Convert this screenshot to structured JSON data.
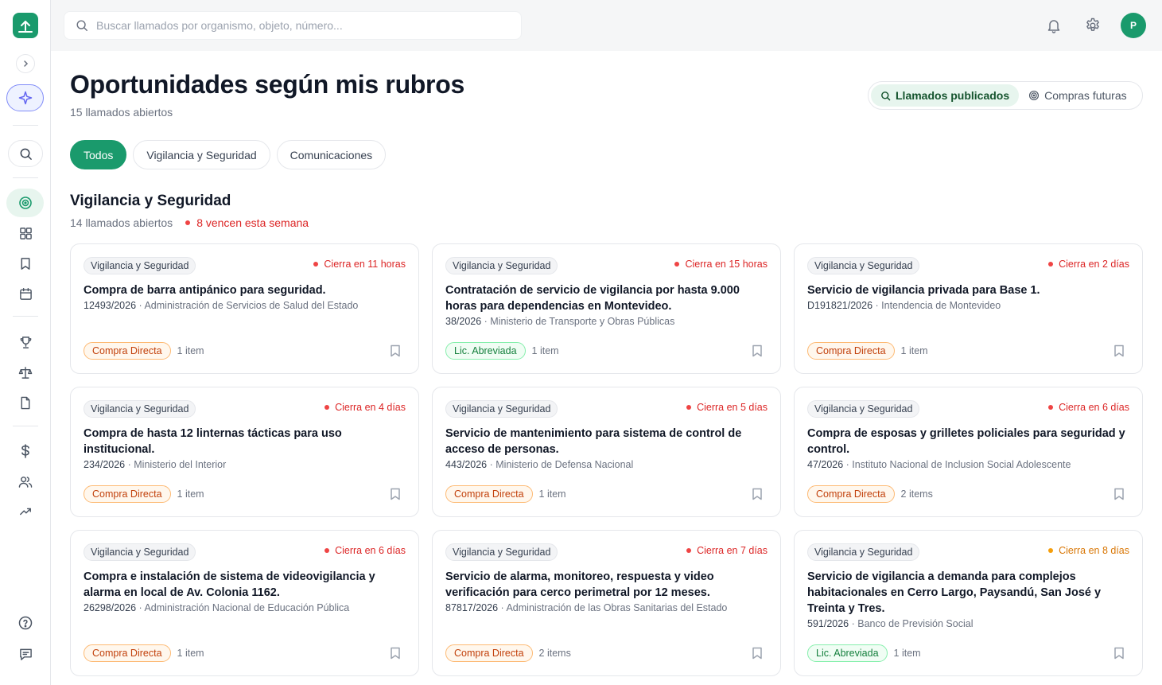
{
  "search": {
    "placeholder": "Buscar llamados por organismo, objeto, número..."
  },
  "user": {
    "initial": "P"
  },
  "page": {
    "title": "Oportunidades según mis rubros",
    "subtitle": "15 llamados abiertos"
  },
  "segments": [
    {
      "label": "Llamados publicados",
      "active": true
    },
    {
      "label": "Compras futuras",
      "active": false
    }
  ],
  "filters": [
    "Todos",
    "Vigilancia y Seguridad",
    "Comunicaciones"
  ],
  "section": {
    "title": "Vigilancia y Seguridad",
    "open_count": "14 llamados abiertos",
    "warning": "8 vencen esta semana"
  },
  "cards": [
    {
      "tag": "Vigilancia y Seguridad",
      "deadline": "Cierra en 11 horas",
      "urgency": "red",
      "title": "Compra de barra antipánico para seguridad.",
      "number": "12493/2026",
      "org": "Administración de Servicios de Salud del Estado",
      "type": "Compra Directa",
      "type_color": "orange",
      "items": "1 item"
    },
    {
      "tag": "Vigilancia y Seguridad",
      "deadline": "Cierra en 15 horas",
      "urgency": "red",
      "title": "Contratación de servicio de vigilancia por hasta 9.000 horas para dependencias en Montevideo.",
      "number": "38/2026",
      "org": "Ministerio de Transporte y Obras Públicas",
      "type": "Lic. Abreviada",
      "type_color": "green",
      "items": "1 item"
    },
    {
      "tag": "Vigilancia y Seguridad",
      "deadline": "Cierra en 2 días",
      "urgency": "red",
      "title": "Servicio de vigilancia privada para Base 1.",
      "number": "D191821/2026",
      "org": "Intendencia de Montevideo",
      "type": "Compra Directa",
      "type_color": "orange",
      "items": "1 item"
    },
    {
      "tag": "Vigilancia y Seguridad",
      "deadline": "Cierra en 4 días",
      "urgency": "red",
      "title": "Compra de hasta 12 linternas tácticas para uso institucional.",
      "number": "234/2026",
      "org": "Ministerio del Interior",
      "type": "Compra Directa",
      "type_color": "orange",
      "items": "1 item"
    },
    {
      "tag": "Vigilancia y Seguridad",
      "deadline": "Cierra en 5 días",
      "urgency": "red",
      "title": "Servicio de mantenimiento para sistema de control de acceso de personas.",
      "number": "443/2026",
      "org": "Ministerio de Defensa Nacional",
      "type": "Compra Directa",
      "type_color": "orange",
      "items": "1 item"
    },
    {
      "tag": "Vigilancia y Seguridad",
      "deadline": "Cierra en 6 días",
      "urgency": "red",
      "title": "Compra de esposas y grilletes policiales para seguridad y control.",
      "number": "47/2026",
      "org": "Instituto Nacional de Inclusion Social Adolescente",
      "type": "Compra Directa",
      "type_color": "orange",
      "items": "2 items"
    },
    {
      "tag": "Vigilancia y Seguridad",
      "deadline": "Cierra en 6 días",
      "urgency": "red",
      "title": "Compra e instalación de sistema de videovigilancia y alarma en local de Av. Colonia 1162.",
      "number": "26298/2026",
      "org": "Administración Nacional de Educación Pública",
      "type": "Compra Directa",
      "type_color": "orange",
      "items": "1 item"
    },
    {
      "tag": "Vigilancia y Seguridad",
      "deadline": "Cierra en 7 días",
      "urgency": "red",
      "title": "Servicio de alarma, monitoreo, respuesta y video verificación para cerco perimetral por 12 meses.",
      "number": "87817/2026",
      "org": "Administración de las Obras Sanitarias del Estado",
      "type": "Compra Directa",
      "type_color": "orange",
      "items": "2 items"
    },
    {
      "tag": "Vigilancia y Seguridad",
      "deadline": "Cierra en 8 días",
      "urgency": "orange",
      "title": "Servicio de vigilancia a demanda para complejos habitacionales en Cerro Largo, Paysandú, San José y Treinta y Tres.",
      "number": "591/2026",
      "org": "Banco de Previsión Social",
      "type": "Lic. Abreviada",
      "type_color": "green",
      "items": "1 item"
    }
  ]
}
